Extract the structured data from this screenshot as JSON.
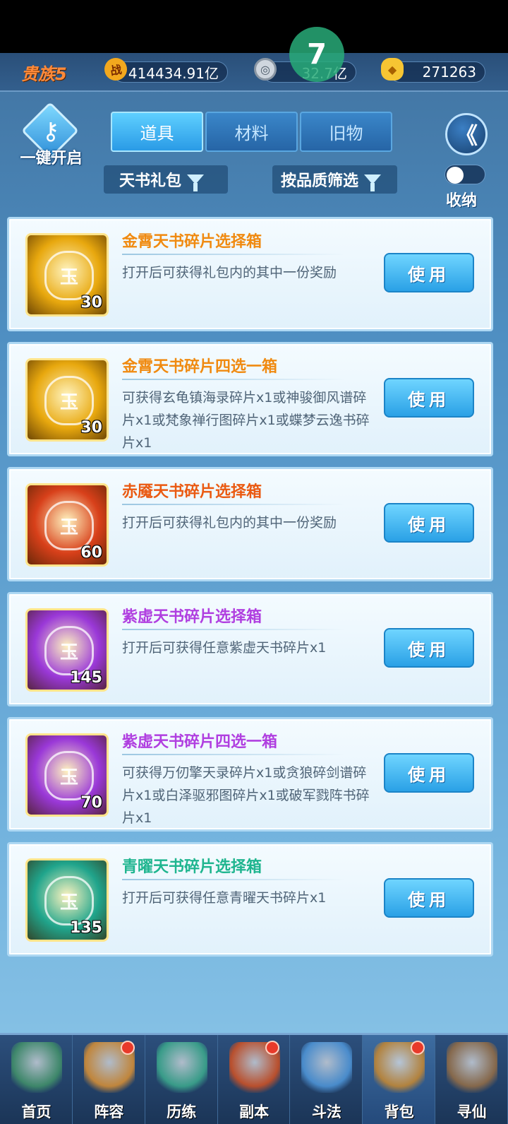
{
  "header": {
    "rank": "贵族5",
    "power": {
      "icon": "battle-power-icon",
      "icon_text": "战",
      "value": "414434.91亿"
    },
    "silver": {
      "icon": "silver-coin-icon",
      "value": "32.7亿"
    },
    "gold": {
      "icon": "gold-ingot-icon",
      "value": "271263"
    }
  },
  "overlay_badge": "7",
  "key_button": {
    "label": "一键开启",
    "icon": "key-icon",
    "glyph": "⚷"
  },
  "tabs": [
    {
      "label": "道具",
      "active": true
    },
    {
      "label": "材料",
      "active": false
    },
    {
      "label": "旧物",
      "active": false
    }
  ],
  "back_button": {
    "icon": "back-arrow-icon",
    "glyph": "《"
  },
  "filters": [
    {
      "label": "天书礼包",
      "icon": "filter-funnel-icon"
    },
    {
      "label": "按品质筛选",
      "icon": "filter-funnel-icon"
    }
  ],
  "collapse_toggle": {
    "label": "收纳",
    "on": false
  },
  "items": [
    {
      "name": "金霄天书碎片选择箱",
      "desc": "打开后可获得礼包内的其中一份奖励",
      "count": "30",
      "button": "使用",
      "rarity": "gold",
      "name_color": "#f08a10",
      "icon_color": "#e8a80e"
    },
    {
      "name": "金霄天书碎片四选一箱",
      "desc": "可获得玄龟镇海录碎片x1或神骏御风谱碎片x1或梵象禅行图碎片x1或蝶梦云逸书碎片x1",
      "count": "30",
      "button": "使用",
      "rarity": "gold",
      "name_color": "#f08a10",
      "icon_color": "#e8a80e"
    },
    {
      "name": "赤魇天书碎片选择箱",
      "desc": "打开后可获得礼包内的其中一份奖励",
      "count": "60",
      "button": "使用",
      "rarity": "red",
      "name_color": "#ea5a12",
      "icon_color": "#d8401a"
    },
    {
      "name": "紫虚天书碎片选择箱",
      "desc": "打开后可获得任意紫虚天书碎片x1",
      "count": "145",
      "button": "使用",
      "rarity": "purple",
      "name_color": "#b03fe0",
      "icon_color": "#9a38d8"
    },
    {
      "name": "紫虚天书碎片四选一箱",
      "desc": "可获得万仞擎天录碎片x1或贪狼碎剑谱碎片x1或白泽驱邪图碎片x1或破军戮阵书碎片x1",
      "count": "70",
      "button": "使用",
      "rarity": "purple",
      "name_color": "#b03fe0",
      "icon_color": "#9a38d8"
    },
    {
      "name": "青曜天书碎片选择箱",
      "desc": "打开后可获得任意青曜天书碎片x1",
      "count": "135",
      "button": "使用",
      "rarity": "cyan",
      "name_color": "#1fb58f",
      "icon_color": "#20a58c"
    }
  ],
  "nav": [
    {
      "label": "首页",
      "icon": "home-island-icon",
      "badge": false,
      "active": false,
      "color": "#3f8a6a"
    },
    {
      "label": "阵容",
      "icon": "lineup-cards-icon",
      "badge": true,
      "active": false,
      "color": "#c8893a"
    },
    {
      "label": "历练",
      "icon": "training-dragon-icon",
      "badge": false,
      "active": false,
      "color": "#3aa08a"
    },
    {
      "label": "副本",
      "icon": "dungeon-gate-icon",
      "badge": true,
      "active": false,
      "color": "#c0502a"
    },
    {
      "label": "斗法",
      "icon": "battle-sword-icon",
      "badge": false,
      "active": false,
      "color": "#4b8fd0"
    },
    {
      "label": "背包",
      "icon": "backpack-icon",
      "badge": true,
      "active": true,
      "color": "#b8843a"
    },
    {
      "label": "寻仙",
      "icon": "scroll-search-icon",
      "badge": false,
      "active": false,
      "color": "#8a6a4a"
    }
  ],
  "placeholder_glyph": "玉"
}
